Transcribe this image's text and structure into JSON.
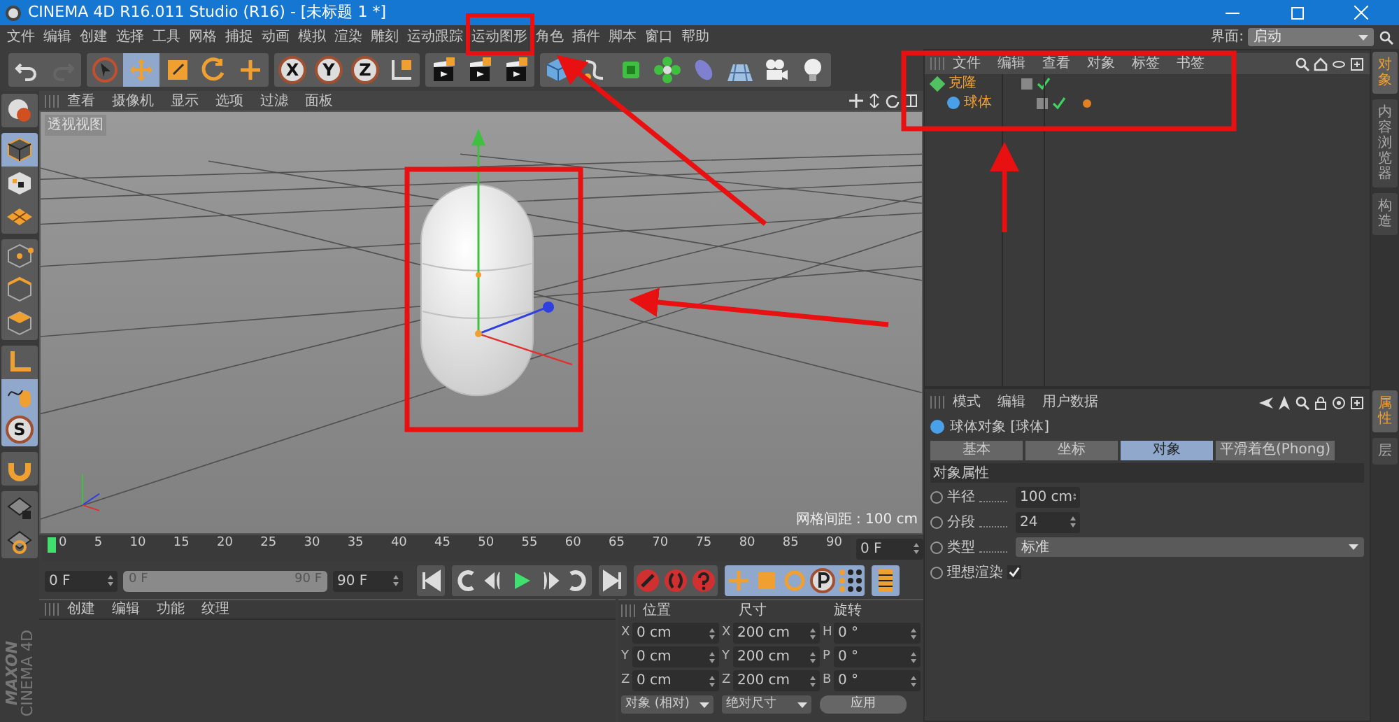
{
  "window": {
    "title": "CINEMA 4D R16.011 Studio (R16) - [未标题 1 *]"
  },
  "menu": [
    "文件",
    "编辑",
    "创建",
    "选择",
    "工具",
    "网格",
    "捕捉",
    "动画",
    "模拟",
    "渲染",
    "雕刻",
    "运动跟踪",
    "运动图形",
    "角色",
    "插件",
    "脚本",
    "窗口",
    "帮助"
  ],
  "layout": {
    "label": "界面:",
    "value": "启动"
  },
  "toolbar": [
    [
      {
        "kind": "undo",
        "selected": false
      },
      {
        "kind": "redo",
        "selected": false
      }
    ],
    [
      {
        "kind": "pointer",
        "selected": false
      },
      {
        "kind": "move",
        "selected": true
      },
      {
        "kind": "scale",
        "selected": false
      },
      {
        "kind": "rotate",
        "selected": false
      },
      {
        "kind": "plus",
        "selected": false
      }
    ],
    [
      {
        "kind": "letter",
        "label": "X",
        "selected": false
      },
      {
        "kind": "letter",
        "label": "Y",
        "selected": false
      },
      {
        "kind": "letter",
        "label": "Z",
        "selected": false
      },
      {
        "kind": "coord",
        "selected": false
      }
    ],
    [
      {
        "kind": "render",
        "selected": false
      },
      {
        "kind": "render",
        "selected": false
      },
      {
        "kind": "render",
        "selected": false
      }
    ],
    [
      {
        "kind": "cube",
        "selected": false
      },
      {
        "kind": "spline",
        "selected": false
      },
      {
        "kind": "nurbs",
        "selected": false
      },
      {
        "kind": "cloner",
        "selected": false
      },
      {
        "kind": "deformer",
        "selected": false
      },
      {
        "kind": "floor",
        "selected": false
      },
      {
        "kind": "camera",
        "selected": false
      },
      {
        "kind": "light",
        "selected": false
      }
    ]
  ],
  "modes": [
    [
      {
        "kind": "model",
        "selected": false
      }
    ],
    [
      {
        "kind": "object",
        "selected": true
      },
      {
        "kind": "texture",
        "selected": false
      },
      {
        "kind": "workplane",
        "selected": false
      }
    ],
    [
      {
        "kind": "points",
        "selected": false
      },
      {
        "kind": "edges",
        "selected": false
      },
      {
        "kind": "polygons",
        "selected": false
      }
    ],
    [
      {
        "kind": "axis",
        "selected": false
      },
      {
        "kind": "tweak",
        "selected": true
      },
      {
        "kind": "letter",
        "label": "S",
        "selected": true
      }
    ],
    [
      {
        "kind": "magnet",
        "selected": false
      }
    ],
    [
      {
        "kind": "lockgrid",
        "selected": false
      },
      {
        "kind": "animgrid",
        "selected": false
      }
    ]
  ],
  "logo": {
    "brand": "MAXON",
    "product": "CINEMA 4D"
  },
  "viewport": {
    "menu": [
      "查看",
      "摄像机",
      "显示",
      "选项",
      "过滤",
      "面板"
    ],
    "view_name": "透视视图",
    "grid_info": "网格间距 : 100 cm"
  },
  "timeline": {
    "ticks": [
      "0",
      "5",
      "10",
      "15",
      "20",
      "25",
      "30",
      "35",
      "40",
      "45",
      "50",
      "55",
      "60",
      "65",
      "70",
      "75",
      "80",
      "85",
      "90"
    ],
    "playhead": {
      "level": 0
    },
    "frame": "0 F",
    "start": "0 F",
    "range": {
      "start": "0 F",
      "end": "90 F",
      "level": 1
    },
    "end": "90 F",
    "transport": [
      [
        {
          "kind": "first"
        }
      ],
      [
        {
          "kind": "loopback"
        },
        {
          "kind": "prev"
        },
        {
          "kind": "play"
        },
        {
          "kind": "next"
        },
        {
          "kind": "loop"
        }
      ],
      [
        {
          "kind": "last"
        }
      ],
      [
        {
          "kind": "record"
        },
        {
          "kind": "autokey"
        },
        {
          "kind": "keyhelp"
        }
      ],
      [
        {
          "kind": "kmove"
        },
        {
          "kind": "kscale"
        },
        {
          "kind": "krotate"
        },
        {
          "kind": "kparam"
        },
        {
          "kind": "kgrid"
        }
      ],
      [
        {
          "kind": "film"
        }
      ]
    ]
  },
  "materials": {
    "menu": [
      "创建",
      "编辑",
      "功能",
      "纹理"
    ]
  },
  "coordinates": {
    "headers": [
      "位置",
      "尺寸",
      "旋转"
    ],
    "rows": [
      [
        {
          "axis": "X",
          "value": "0 cm"
        },
        {
          "axis": "X",
          "value": "200 cm"
        },
        {
          "axis": "H",
          "value": "0 °"
        }
      ],
      [
        {
          "axis": "Y",
          "value": "0 cm"
        },
        {
          "axis": "Y",
          "value": "200 cm"
        },
        {
          "axis": "P",
          "value": "0 °"
        }
      ],
      [
        {
          "axis": "Z",
          "value": "0 cm"
        },
        {
          "axis": "Z",
          "value": "200 cm"
        },
        {
          "axis": "B",
          "value": "0 °"
        }
      ]
    ],
    "mode": "对象 (相对)",
    "size_mode": "绝对尺寸",
    "apply": "应用"
  },
  "objects": {
    "menu": [
      "文件",
      "编辑",
      "查看",
      "对象",
      "标签",
      "书签"
    ],
    "tree": [
      {
        "name": "克隆",
        "kind": "cloner",
        "children": [
          {
            "name": "球体",
            "kind": "sphere"
          }
        ]
      }
    ],
    "side_tabs": [
      {
        "label": "对象",
        "selected": true
      },
      {
        "label": "内容浏览器",
        "selected": false
      },
      {
        "label": "构造",
        "selected": false
      }
    ]
  },
  "attributes": {
    "menu": [
      "模式",
      "编辑",
      "用户数据"
    ],
    "title": "球体对象 [球体]",
    "tabs": [
      {
        "label": "基本",
        "selected": false
      },
      {
        "label": "坐标",
        "selected": false
      },
      {
        "label": "对象",
        "selected": true
      },
      {
        "label": "平滑着色(Phong)",
        "selected": false
      }
    ],
    "section": "对象属性",
    "fields": [
      {
        "kind": "number",
        "label": "半径",
        "value": "100 cm"
      },
      {
        "kind": "number",
        "label": "分段",
        "value": "24"
      },
      {
        "kind": "select",
        "label": "类型",
        "value": "标准"
      },
      {
        "kind": "checkbox",
        "label": "理想渲染",
        "checked": true
      }
    ],
    "side_tabs": [
      {
        "label": "属性",
        "selected": true
      },
      {
        "label": "层",
        "selected": false
      }
    ]
  }
}
